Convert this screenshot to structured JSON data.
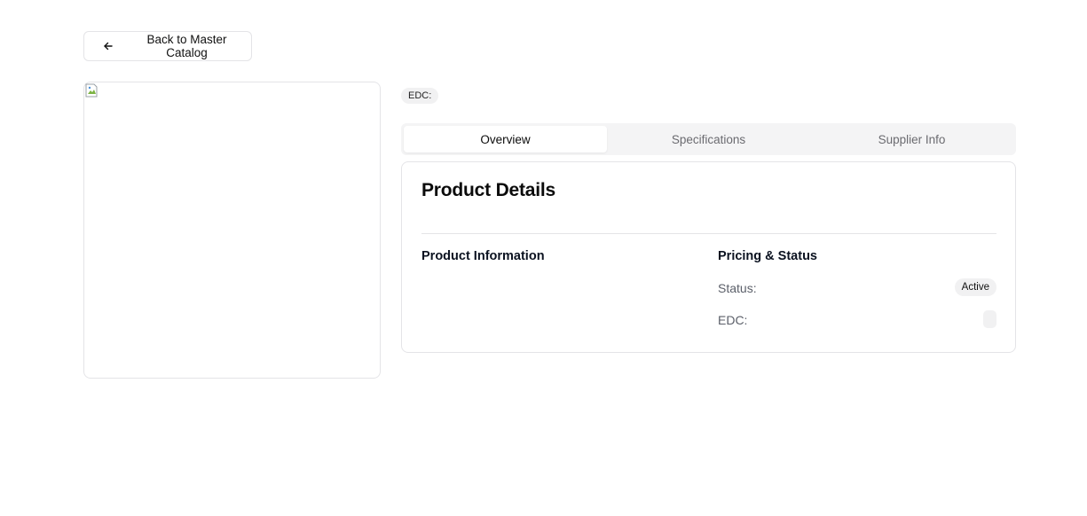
{
  "back_button": {
    "label": "Back to Master Catalog",
    "icon": "arrow-left-icon"
  },
  "product_image": {
    "state": "broken-image-icon"
  },
  "header": {
    "edc_badge": "EDC:"
  },
  "tabs": [
    {
      "label": "Overview",
      "active": true
    },
    {
      "label": "Specifications",
      "active": false
    },
    {
      "label": "Supplier Info",
      "active": false
    }
  ],
  "details": {
    "title": "Product Details",
    "product_info_heading": "Product Information",
    "pricing_heading": "Pricing & Status",
    "status_label": "Status:",
    "status_value": "Active",
    "edc_label": "EDC:",
    "edc_value": ""
  },
  "colors": {
    "border": "#e4e4e7",
    "badge_bg": "#f1f1f2",
    "tab_bar_bg": "#f4f4f5",
    "muted_text": "#6b6b70"
  }
}
